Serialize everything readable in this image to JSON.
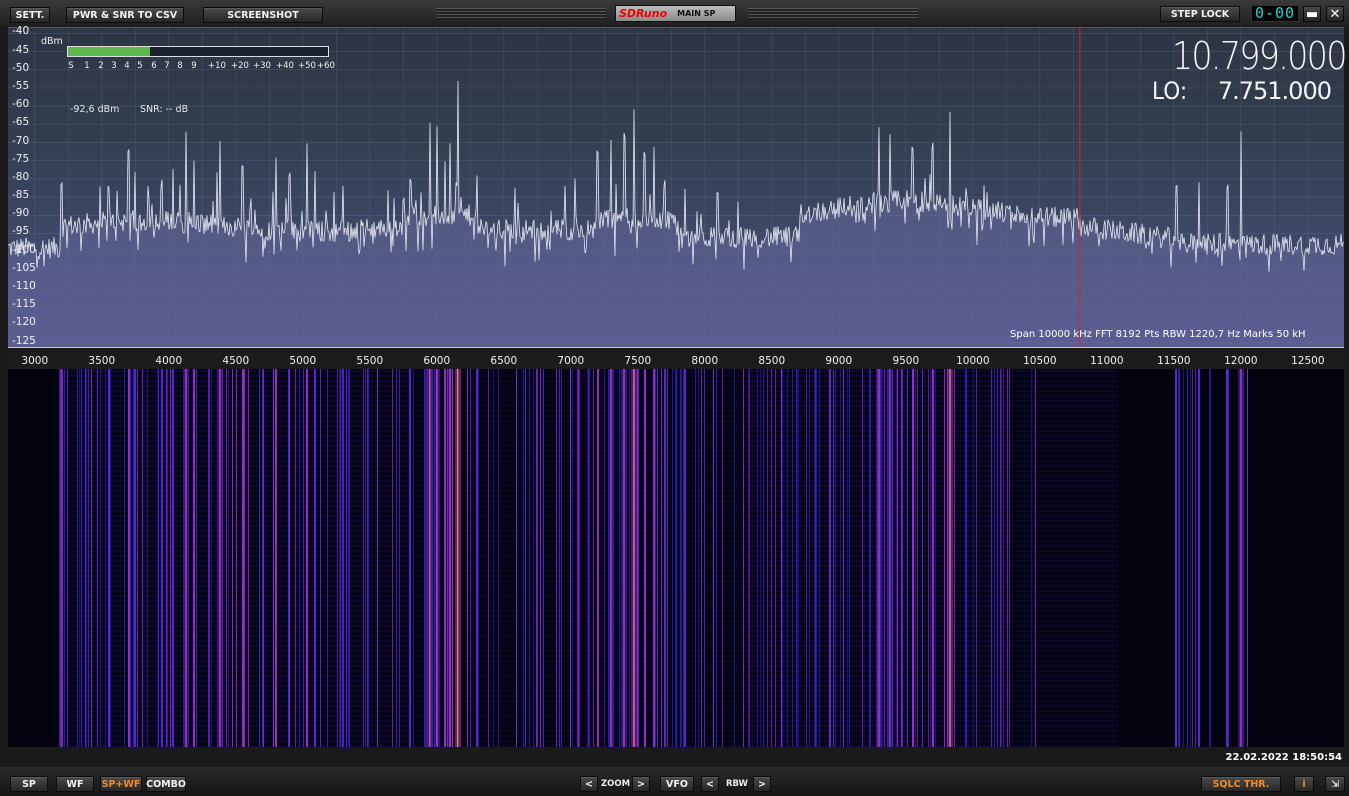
{
  "toolbar": {
    "settings": "SETT.",
    "pwr_snr_csv": "PWR & SNR TO CSV",
    "screenshot": "SCREENSHOT",
    "brand": "SDRuno",
    "mode": "MAIN SP",
    "step_lock": "STEP LOCK",
    "step_display": "0-00",
    "minimize": "▬",
    "close": "✕"
  },
  "spectrum": {
    "unit": "dBm",
    "y_ticks": [
      "-40",
      "-45",
      "-50",
      "-55",
      "-60",
      "-65",
      "-70",
      "-75",
      "-80",
      "-85",
      "-90",
      "-95",
      "-100",
      "-105",
      "-110",
      "-115",
      "-120",
      "-125"
    ],
    "smeter_scale": [
      "S",
      "1",
      "2",
      "3",
      "4",
      "5",
      "6",
      "7",
      "8",
      "9",
      "+10",
      "+20",
      "+30",
      "+40",
      "+50",
      "+60"
    ],
    "smeter_level_dbm": -92.6,
    "power_readout": "-92,6 dBm",
    "snr_readout": "SNR: -- dB",
    "vfo_frequency": "10.799.000",
    "lo_label": "LO:",
    "lo_frequency": "7.751.000",
    "span_info": "Span 10000 kHz   FFT 8192 Pts   RBW 1220,7 Hz   Marks 50 kH",
    "x_ticks": [
      "3000",
      "3500",
      "4000",
      "4500",
      "5000",
      "5500",
      "6000",
      "6500",
      "7000",
      "7500",
      "8000",
      "8500",
      "9000",
      "9500",
      "10000",
      "10500",
      "11000",
      "11500",
      "12000",
      "12500"
    ],
    "colors": {
      "trace": "#e6e8f0",
      "fill": "#6f6ea8",
      "marker": "#e02020",
      "grid": "#5a6f8c"
    }
  },
  "waterfall": {
    "timestamp": "22.02.2022 18:50:54"
  },
  "bottombar": {
    "sp": "SP",
    "wf": "WF",
    "spwf": "SP+WF",
    "combo": "COMBO",
    "zoom_prev": "<",
    "zoom_label": "ZOOM",
    "zoom_next": ">",
    "vfo": "VFO",
    "rbw_prev": "<",
    "rbw_label": "RBW",
    "rbw_next": ">",
    "sqlc": "SQLC THR.",
    "info": "i",
    "resize": "⇲"
  }
}
